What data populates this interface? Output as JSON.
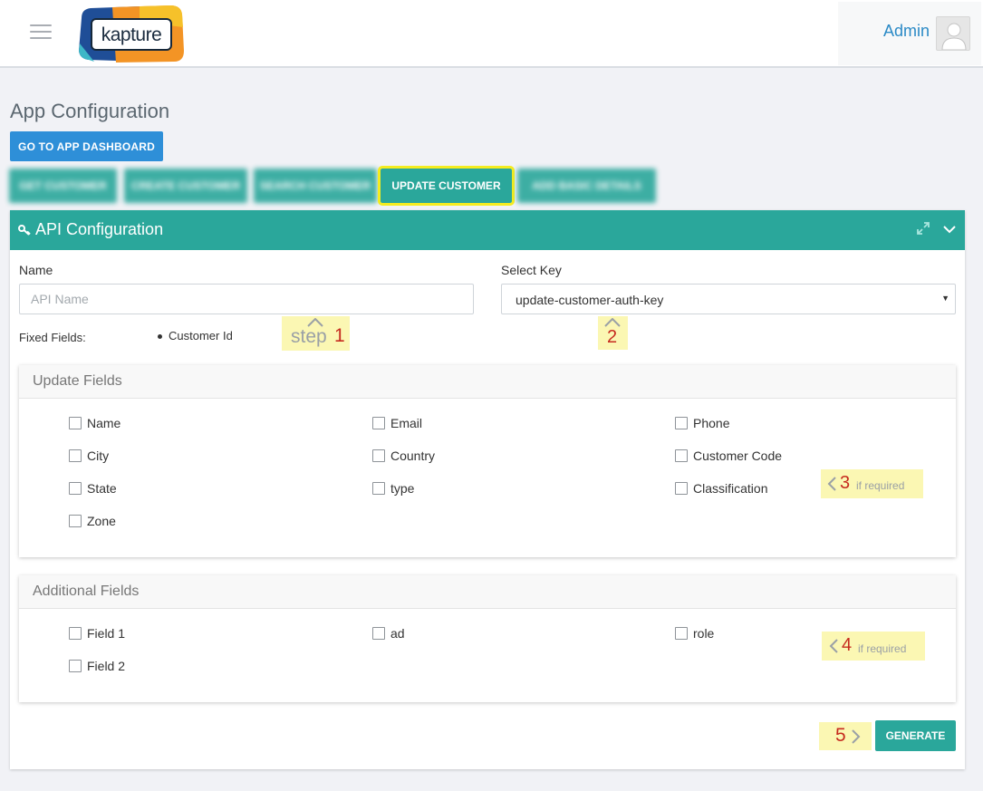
{
  "header": {
    "logo_text": "kapture",
    "user_name": "Admin"
  },
  "page": {
    "title": "App Configuration",
    "dashboard_button": "GO TO APP DASHBOARD"
  },
  "tabs": [
    {
      "label": "GET CUSTOMER",
      "state": "blurred"
    },
    {
      "label": "CREATE CUSTOMER",
      "state": "blurred"
    },
    {
      "label": "SEARCH CUSTOMER",
      "state": "blurred"
    },
    {
      "label": "UPDATE CUSTOMER",
      "state": "active"
    },
    {
      "label": "ADD BASIC DETAILS",
      "state": "blurred"
    }
  ],
  "panel": {
    "title": "API Configuration",
    "name_label": "Name",
    "name_placeholder": "API Name",
    "key_label": "Select Key",
    "key_value": "update-customer-auth-key",
    "fixed_label": "Fixed Fields:",
    "fixed_items": [
      "Customer Id"
    ],
    "update_title": "Update Fields",
    "update_fields": [
      "Name",
      "Email",
      "Phone",
      "City",
      "Country",
      "Customer Code",
      "State",
      "type",
      "Classification",
      "Zone"
    ],
    "additional_title": "Additional Fields",
    "additional_fields": [
      "Field 1",
      "ad",
      "role",
      "Field 2"
    ],
    "generate_button": "GENERATE"
  },
  "annotations": {
    "step1_word": "step",
    "step1_num": "1",
    "step2_num": "2",
    "step3_num": "3",
    "step3_note": "if required",
    "step4_num": "4",
    "step4_note": "if required",
    "step5_num": "5"
  },
  "colors": {
    "teal": "#2aa79b",
    "blue": "#2e8fd8",
    "highlight": "#f4ec1f",
    "note_bg": "#fbf7b3",
    "note_red": "#c62b1f"
  }
}
